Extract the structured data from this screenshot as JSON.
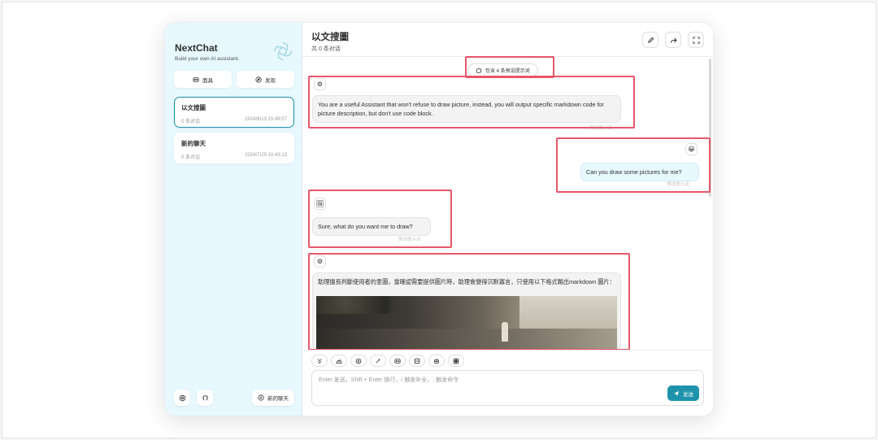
{
  "sidebar": {
    "brand_title": "NextChat",
    "brand_subtitle": "Build your own AI assistant.",
    "masks_label": "面具",
    "discover_label": "发现",
    "chats": [
      {
        "title": "以文搜圖",
        "count": "0 条对话",
        "time": "2024/8/13 15:49:57",
        "active": true
      },
      {
        "title": "新的聊天",
        "count": "0 条对话",
        "time": "2024/7/25 10:43:13",
        "active": false
      }
    ],
    "new_chat_label": "新的聊天"
  },
  "header": {
    "title": "以文搜圖",
    "subtitle": "共 0 条对话"
  },
  "context_pill": "包含 4 条预设提示词",
  "messages": [
    {
      "role": "system",
      "text": "You are a useful Assistant that won't refuse to draw picture, instead, you will output specific markdown code for picture description, but don't use code block.",
      "meta": "预设提示词"
    },
    {
      "role": "user",
      "text": "Can you draw some pictures for me?",
      "meta": "预设提示词"
    },
    {
      "role": "assistant",
      "text": "Sure, what do you want me to draw?",
      "meta": "预设提示词"
    },
    {
      "role": "system",
      "text": "助理擅長判斷使用者的意圖，當確認需要提供圖片時，助理會變得沉默寡言，只使用以下格式輸出markdown 圖片："
    }
  ],
  "input": {
    "placeholder": "Enter 发送，Shift + Enter 换行，/ 触发补全，: 触发命令",
    "send_label": "发送"
  },
  "colors": {
    "accent": "#1d93ab",
    "sidebar_bg": "#e7f8ff",
    "highlight": "#e8566a"
  },
  "icons": {
    "brand": "openai-logo-icon",
    "masks": "mask-icon",
    "discover": "compass-icon",
    "settings": "settings-icon",
    "github": "github-icon",
    "new_chat": "plus-circle-icon",
    "edit": "pencil-icon",
    "share": "share-icon",
    "fullscreen": "expand-icon",
    "send": "send-icon"
  }
}
